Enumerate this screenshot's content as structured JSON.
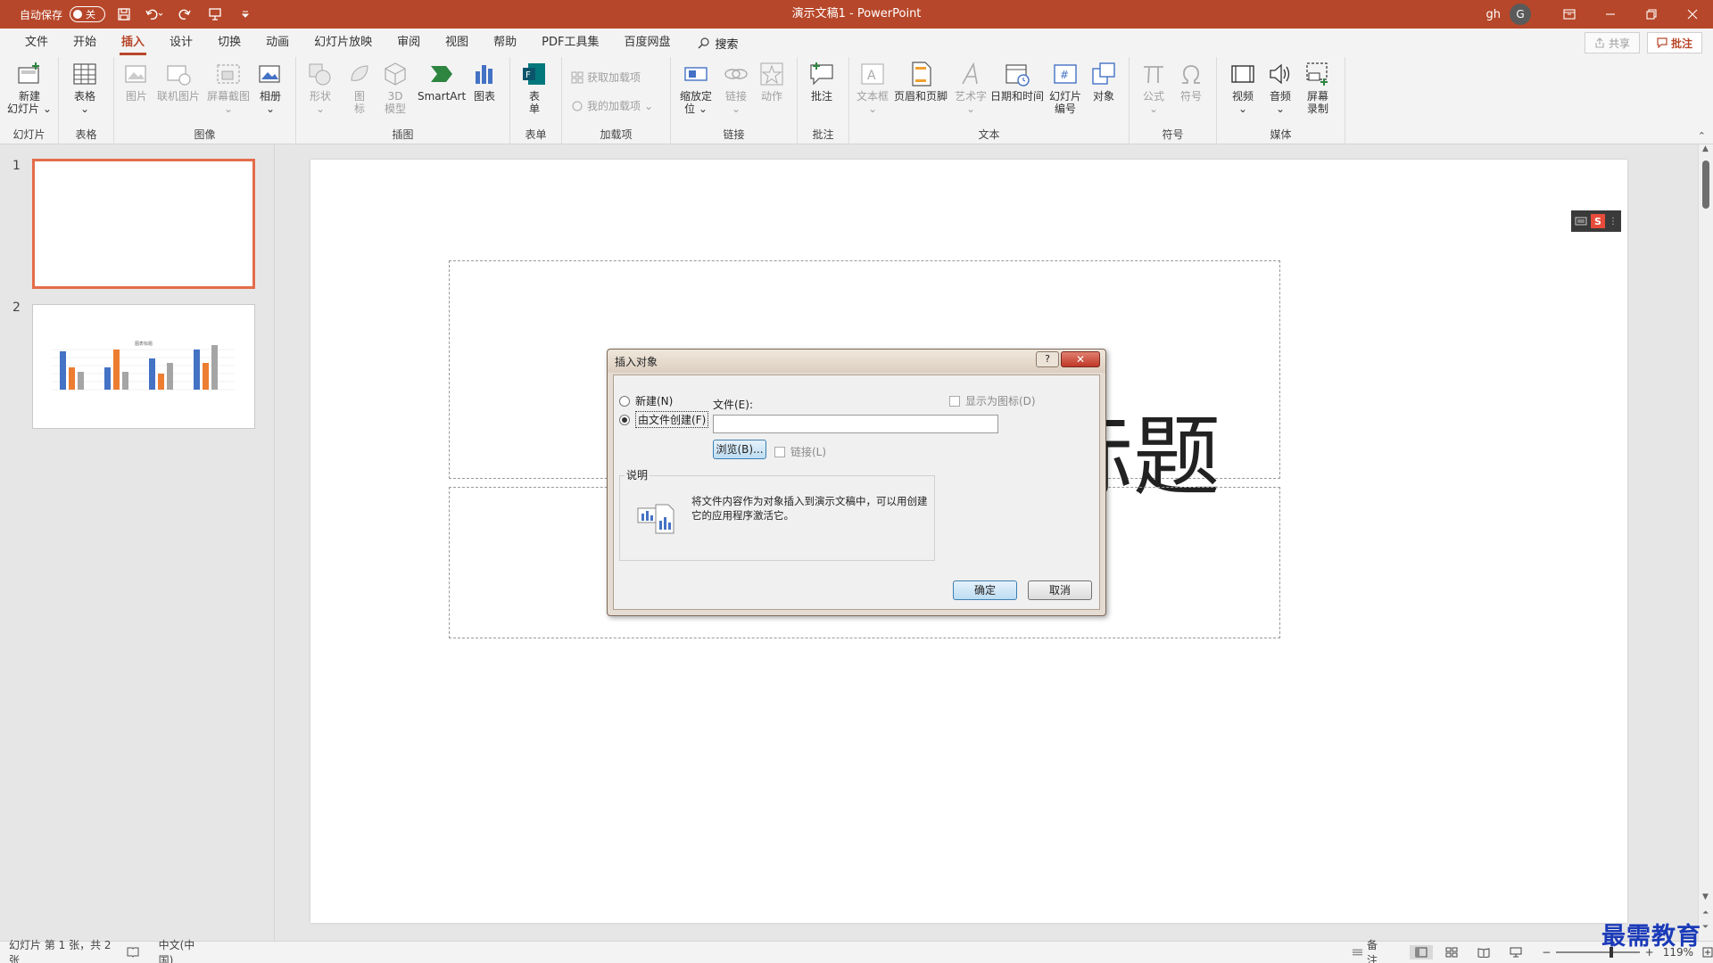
{
  "titlebar": {
    "autosave_label": "自动保存",
    "autosave_state": "关",
    "doc_title": "演示文稿1  -  PowerPoint",
    "user_name": "gh",
    "avatar_initial": "G",
    "quick_icons": [
      "save-icon",
      "undo-icon",
      "redo-icon",
      "present-icon",
      "customize-icon"
    ],
    "window_icons": [
      "ribbon-display-icon",
      "minimize-icon",
      "restore-icon",
      "close-icon"
    ]
  },
  "menu": {
    "tabs": [
      "文件",
      "开始",
      "插入",
      "设计",
      "切换",
      "动画",
      "幻灯片放映",
      "审阅",
      "视图",
      "帮助",
      "PDF工具集",
      "百度网盘"
    ],
    "active_tab": "插入",
    "search_label": "搜索",
    "share_label": "共享",
    "comment_label": "批注"
  },
  "ribbon": {
    "groups": {
      "slides": "幻灯片",
      "tables": "表格",
      "images": "图像",
      "illustrations": "插图",
      "forms": "表单",
      "addins": "加载项",
      "links": "链接",
      "comments": "批注",
      "text": "文本",
      "symbols": "符号",
      "media": "媒体"
    },
    "buttons": {
      "new_slide_1": "新建",
      "new_slide_2": "幻灯片",
      "table": "表格",
      "picture": "图片",
      "online_picture": "联机图片",
      "screenshot": "屏幕截图",
      "album": "相册",
      "shapes": "形状",
      "icons_1": "图",
      "icons_2": "标",
      "model3d_1": "3D",
      "model3d_2": "模型",
      "smartart": "SmartArt",
      "chart": "图表",
      "form_1": "表",
      "form_2": "单",
      "get_addins": "获取加载项",
      "my_addins": "我的加载项",
      "zoom_1": "缩放定",
      "zoom_2": "位",
      "link": "链接",
      "action": "动作",
      "comment": "批注",
      "textbox": "文本框",
      "header_footer": "页眉和页脚",
      "wordart": "艺术字",
      "datetime": "日期和时间",
      "slide_number_1": "幻灯片",
      "slide_number_2": "编号",
      "object": "对象",
      "equation": "公式",
      "symbol": "符号",
      "video": "视频",
      "audio": "音频",
      "screen_record_1": "屏幕",
      "screen_record_2": "录制"
    }
  },
  "thumbnails": {
    "items": [
      {
        "num": "1",
        "selected": true
      },
      {
        "num": "2",
        "selected": false
      }
    ],
    "slide2_title": "图表标题"
  },
  "slide": {
    "title_visible": "加标题",
    "subtitle_visible": "题",
    "tool_logo": "S"
  },
  "dialog": {
    "title": "插入对象",
    "help": "?",
    "close": "✕",
    "radio_new": "新建(N)",
    "radio_from_file": "由文件创建(F)",
    "file_label": "文件(E):",
    "file_value": "",
    "browse": "浏览(B)...",
    "link": "链接(L)",
    "display_as_icon": "显示为图标(D)",
    "desc_title": "说明",
    "desc_text": "将文件内容作为对象插入到演示文稿中，可以用创建它的应用程序激活它。",
    "ok": "确定",
    "cancel": "取消"
  },
  "statusbar": {
    "slide_info": "幻灯片 第 1 张，共 2 张",
    "language": "中文(中国)",
    "notes": "备注",
    "zoom_minus": "−",
    "zoom_plus": "+",
    "zoom": "119%"
  },
  "watermark": "最需教育",
  "colors": {
    "accent": "#b7472a",
    "selection": "#e46c4a",
    "bar_blue": "#4472c4",
    "bar_orange": "#ed7d31",
    "bar_gray": "#a5a5a5"
  }
}
